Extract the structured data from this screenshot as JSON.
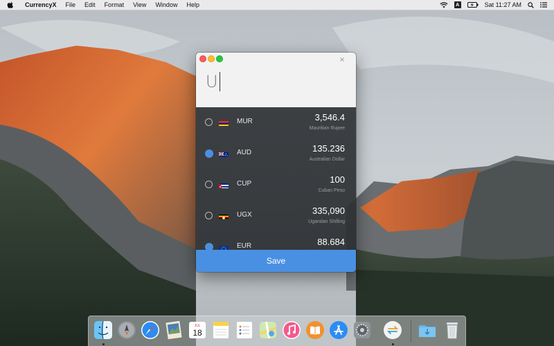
{
  "menubar": {
    "app_name": "CurrencyX",
    "menus": [
      "File",
      "Edit",
      "Format",
      "View",
      "Window",
      "Help"
    ],
    "input_source": "A",
    "clock": "Sat 11:27 AM",
    "icons": [
      "apple-icon",
      "wifi-icon",
      "input-source-icon",
      "battery-charging-icon",
      "spotlight-search-icon",
      "notification-center-icon"
    ]
  },
  "window": {
    "search_value": "U",
    "currencies": [
      {
        "code": "MUR",
        "amount": "3,546.4",
        "name": "Mauritian Rupee",
        "selected": false,
        "flag": "mauritius"
      },
      {
        "code": "AUD",
        "amount": "135.236",
        "name": "Australian Dollar",
        "selected": true,
        "flag": "australia"
      },
      {
        "code": "CUP",
        "amount": "100",
        "name": "Cuban Peso",
        "selected": false,
        "flag": "cuba"
      },
      {
        "code": "UGX",
        "amount": "335,090",
        "name": "Ugandan Shilling",
        "selected": false,
        "flag": "uganda"
      },
      {
        "code": "EUR",
        "amount": "88.684",
        "name": "",
        "selected": true,
        "flag": "european-union"
      }
    ],
    "save_label": "Save",
    "accent_color": "#4a90e2"
  },
  "dock": {
    "calendar_day": "18",
    "calendar_month": "JUL",
    "apps": [
      "finder",
      "launchpad",
      "safari",
      "preview",
      "calendar",
      "notes",
      "reminders",
      "maps",
      "itunes",
      "ibooks",
      "app-store",
      "system-preferences",
      "currencyx",
      "downloads",
      "trash"
    ]
  }
}
